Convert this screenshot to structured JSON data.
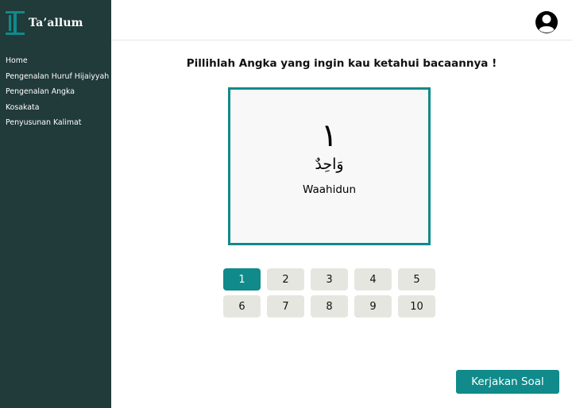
{
  "app": {
    "title": "Ta’allum"
  },
  "sidebar": {
    "items": [
      {
        "label": "Home"
      },
      {
        "label": "Pengenalan Huruf Hijaiyyah"
      },
      {
        "label": "Pengenalan Angka"
      },
      {
        "label": "Kosakata"
      },
      {
        "label": "Penyusunan Kalimat"
      }
    ]
  },
  "header": {
    "avatar_icon": "user-avatar-icon"
  },
  "main": {
    "heading": "Pillihlah Angka yang ingin kau ketahui bacaannya !",
    "card": {
      "numeral": "١",
      "arabic_word": "وَاحِدٌ",
      "latin": "Waahidun"
    },
    "numbers": [
      "1",
      "2",
      "3",
      "4",
      "5",
      "6",
      "7",
      "8",
      "9",
      "10"
    ],
    "selected": "1",
    "cta_label": "Kerjakan Soal"
  },
  "colors": {
    "sidebar": "#213a3a",
    "accent": "#108a8a",
    "number_button": "#e6e6e0"
  }
}
